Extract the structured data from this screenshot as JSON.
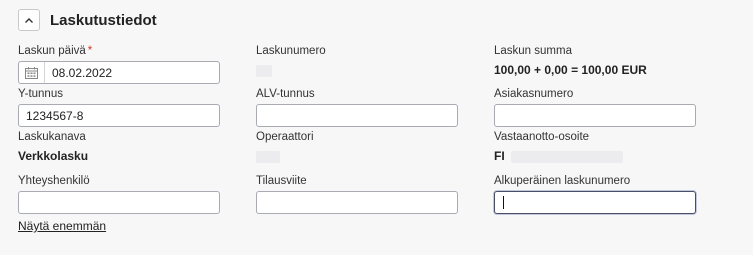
{
  "section": {
    "title": "Laskutustiedot"
  },
  "fields": {
    "invoice_date": {
      "label": "Laskun päivä",
      "required_mark": "*",
      "value": "08.02.2022"
    },
    "invoice_number": {
      "label": "Laskunumero"
    },
    "invoice_sum": {
      "label": "Laskun summa",
      "value": "100,00 + 0,00 = 100,00 EUR"
    },
    "business_id": {
      "label": "Y-tunnus",
      "value": "1234567-8"
    },
    "vat_id": {
      "label": "ALV-tunnus",
      "value": ""
    },
    "customer_number": {
      "label": "Asiakasnumero",
      "value": ""
    },
    "invoice_channel": {
      "label": "Laskukanava",
      "value": "Verkkolasku"
    },
    "operator": {
      "label": "Operaattori"
    },
    "receiving_address": {
      "label": "Vastaanotto-osoite",
      "value": "FI"
    },
    "contact_person": {
      "label": "Yhteyshenkilö",
      "value": ""
    },
    "order_reference": {
      "label": "Tilausviite",
      "value": ""
    },
    "original_invoice_number": {
      "label": "Alkuperäinen laskunumero",
      "value": ""
    }
  },
  "actions": {
    "show_more": "Näytä enemmän"
  },
  "icons": {
    "collapse": "chevron-up-icon",
    "calendar": "calendar-icon"
  },
  "colors": {
    "required": "#d2352b",
    "background": "#f7f7f8",
    "input_border": "#a9abb2",
    "focus_border": "#4b4f66"
  }
}
